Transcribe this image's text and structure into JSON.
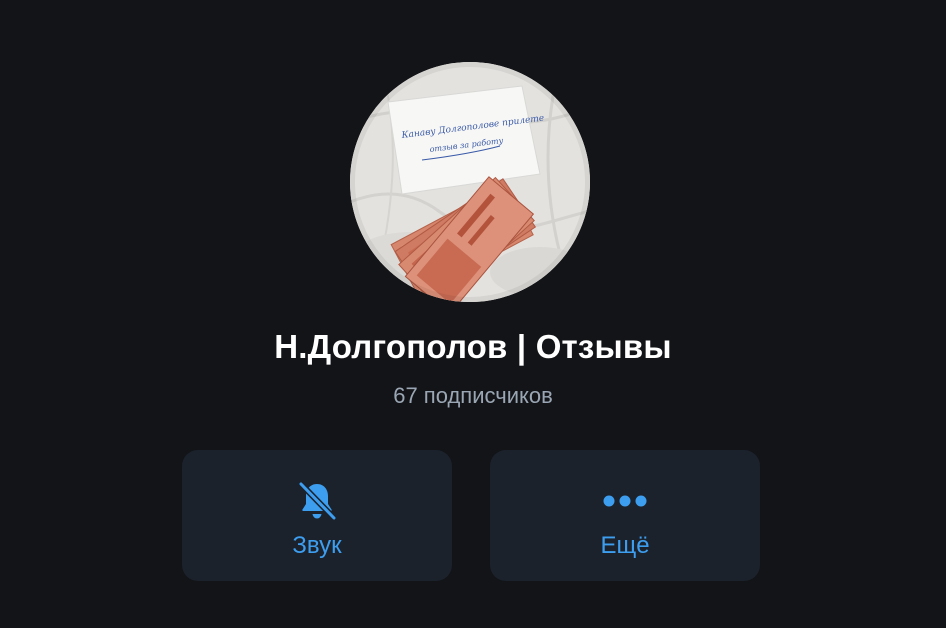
{
  "channel": {
    "title": "Н.Долгополов | Отзывы",
    "subscribers": "67 подписчиков"
  },
  "avatar": {
    "note_line1": "Канаву Долгополове прилете",
    "note_line2": "отзыв за работу"
  },
  "actions": {
    "sound_label": "Звук",
    "sound_icon": "bell-muted-icon",
    "more_label": "Ещё",
    "more_icon": "ellipsis-icon"
  },
  "colors": {
    "background": "#131417",
    "button_background": "#1b222c",
    "accent": "#3d9ef0",
    "title": "#ffffff",
    "subtitle": "#9aa6b4"
  }
}
